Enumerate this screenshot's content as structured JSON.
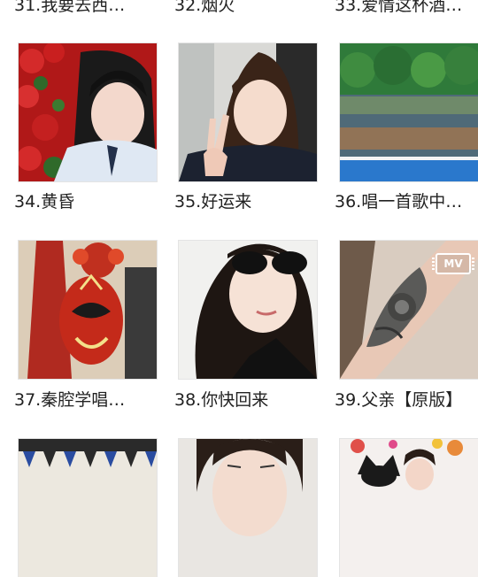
{
  "items": [
    {
      "label": "31.我要去西…",
      "image": "girl-photo"
    },
    {
      "label": "32.烟火",
      "image": "photo"
    },
    {
      "label": "33.爱情这杯酒…",
      "image": "photo"
    },
    {
      "label": "34.黄昏",
      "image": "woman-with-roses"
    },
    {
      "label": "35.好运来",
      "image": "woman-peace-sign"
    },
    {
      "label": "36.唱一首歌中…",
      "image": "lake-landscape"
    },
    {
      "label": "37.秦腔学唱…",
      "image": "opera-mask"
    },
    {
      "label": "38.你快回来",
      "image": "woman-sunglasses"
    },
    {
      "label": "39.父亲【原版】",
      "image": "arm-tattoo",
      "badge": "MV"
    },
    {
      "image": "flags-tent"
    },
    {
      "image": "woman-face"
    },
    {
      "image": "woman-with-cat"
    }
  ]
}
